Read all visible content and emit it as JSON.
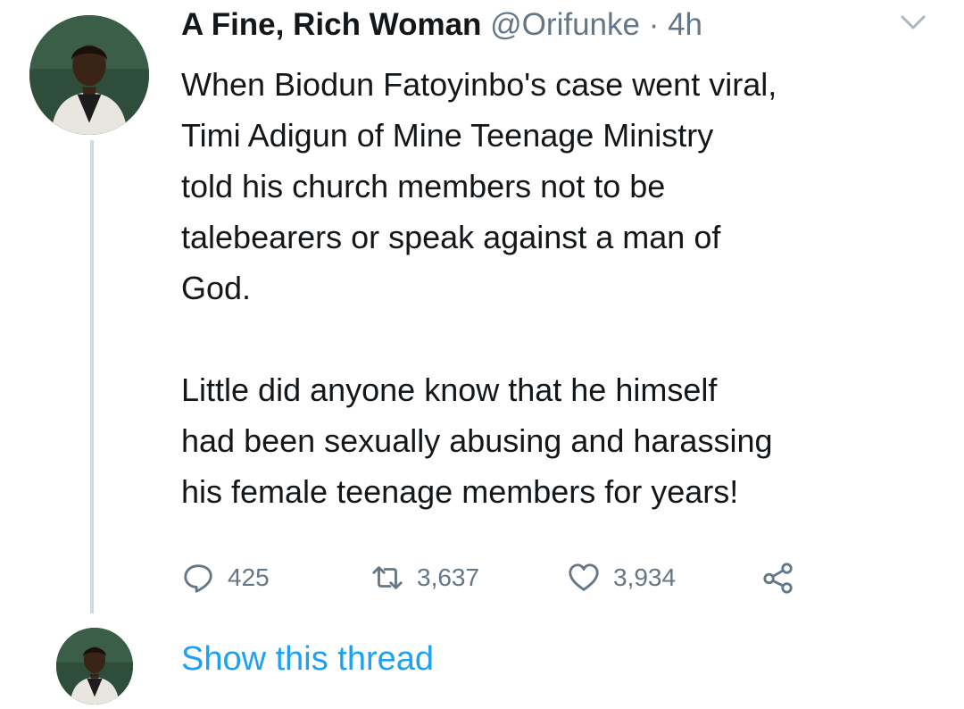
{
  "tweet": {
    "display_name": "A Fine, Rich Woman",
    "handle": "@Orifunke",
    "separator": "·",
    "timestamp": "4h",
    "paragraphs": [
      "When Biodun Fatoyinbo's case went viral,\nTimi Adigun of Mine Teenage Ministry\ntold his church members not to be\ntalebearers or speak against a man of\nGod.",
      "Little did anyone know that he himself\nhad been sexually abusing and harassing\nhis female teenage members for years!"
    ],
    "counts": {
      "replies": "425",
      "retweets": "3,637",
      "likes": "3,934"
    }
  },
  "thread": {
    "show_label": "Show this thread"
  },
  "icons": {
    "reply": "reply-icon",
    "retweet": "retweet-icon",
    "like": "heart-icon",
    "share": "share-icon",
    "menu": "chevron-down-icon"
  },
  "colors": {
    "text": "#14171a",
    "muted": "#657786",
    "link": "#1da1f2",
    "thread_line": "#cfd9de"
  }
}
